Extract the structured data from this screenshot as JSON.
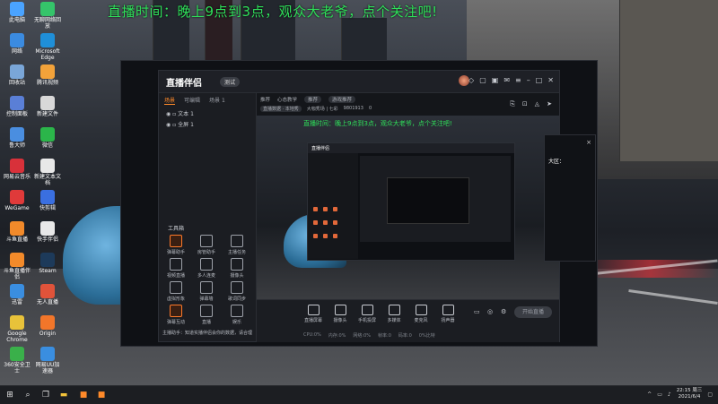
{
  "banner": "直播时间：晚上9点到3点，观众大老爷，点个关注吧!",
  "desktop_icons": [
    {
      "label": "此电脑",
      "color": "#4aa3ff"
    },
    {
      "label": "无聊网络回放",
      "color": "#35c46a"
    },
    {
      "label": "网络",
      "color": "#3b8be0"
    },
    {
      "label": "Microsoft Edge",
      "color": "#1f8fd8"
    },
    {
      "label": "回收站",
      "color": "#7aa6d8"
    },
    {
      "label": "腾讯视频",
      "color": "#f2a23a"
    },
    {
      "label": "控制面板",
      "color": "#5a7fd6"
    },
    {
      "label": "新建文件",
      "color": "#d8d8d8"
    },
    {
      "label": "鲁大师",
      "color": "#4a8ee0"
    },
    {
      "label": "微信",
      "color": "#2bb54a"
    },
    {
      "label": "网易云音乐",
      "color": "#d8313a"
    },
    {
      "label": "新建文本文档",
      "color": "#e8e8e8"
    },
    {
      "label": "WeGame",
      "color": "#e03a3a"
    },
    {
      "label": "快剪辑",
      "color": "#3a6fe0"
    },
    {
      "label": "斗鱼直播",
      "color": "#f28a2a"
    },
    {
      "label": "快手伴侣",
      "color": "#e8e8e8"
    },
    {
      "label": "斗鱼直播伴侣",
      "color": "#f28a2a"
    },
    {
      "label": "Steam",
      "color": "#1d3a5a"
    },
    {
      "label": "迅雷",
      "color": "#3a8ee0"
    },
    {
      "label": "无人直播",
      "color": "#e0533a"
    },
    {
      "label": "Google Chrome",
      "color": "#e8c23a"
    },
    {
      "label": "Origin",
      "color": "#f2762a"
    },
    {
      "label": "360安全卫士",
      "color": "#3ab04a"
    },
    {
      "label": "网易UU加速器",
      "color": "#3a8ee0"
    }
  ],
  "app": {
    "logo": "直播伴侣",
    "version": "测试",
    "title_icons": [
      "shirt-icon",
      "chat-icon",
      "gift-icon",
      "mail-icon",
      "menu-icon",
      "minimize-icon",
      "maximize-icon",
      "close-icon"
    ],
    "left_tabs": [
      "场景",
      "可编辑",
      "场景 1"
    ],
    "sources": [
      "文本 1",
      "全屏 1"
    ],
    "tools_title": "工具箱",
    "tools": [
      {
        "label": "弹幕助手",
        "hot": true
      },
      {
        "label": "房管助手",
        "hot": false
      },
      {
        "label": "主播任务",
        "hot": false
      },
      {
        "label": "视频直播",
        "hot": false
      },
      {
        "label": "多人连麦",
        "hot": false
      },
      {
        "label": "摄像头",
        "hot": false
      },
      {
        "label": "虚拟形象",
        "hot": false
      },
      {
        "label": "弹幕墙",
        "hot": false
      },
      {
        "label": "歌词同步",
        "hot": false
      },
      {
        "label": "弹幕互动",
        "hot": true
      },
      {
        "label": "直播",
        "hot": false
      },
      {
        "label": "娱乐",
        "hot": false
      }
    ],
    "notice": "主播助手：知道实播伴侣会你的数据，请合理取用管理",
    "scene_tabs": [
      "推荐",
      "心态教学",
      "推荐",
      "游戏推荐"
    ],
    "info": [
      "直播数据 · 本地秀",
      "大咖秀场 | 七彩",
      "9801913",
      "0"
    ],
    "right_icons": [
      "share-icon",
      "lock-icon",
      "bell-icon",
      "send-icon"
    ],
    "preview_banner": "直播时间：晚上9点到3点，观众大老爷，点个关注吧!",
    "bottom": [
      {
        "label": "直播屏幕",
        "icon": "screen-icon"
      },
      {
        "label": "摄像头",
        "icon": "camera-icon"
      },
      {
        "label": "手机投屏",
        "icon": "phone-icon"
      },
      {
        "label": "多媒体",
        "icon": "media-icon"
      },
      {
        "label": "麦克风",
        "icon": "mic-icon"
      },
      {
        "label": "扬声器",
        "icon": "speaker-icon"
      }
    ],
    "start_label": "开始直播",
    "stats": [
      "CPU:0%",
      "内存:0%",
      "网络:0%",
      "帧率:0",
      "码率:0",
      "0%比特"
    ]
  },
  "side_popup": {
    "title": "大区：",
    "close": "×"
  },
  "taskbar": {
    "icons": [
      "windows-icon",
      "search-icon",
      "taskview-icon",
      "file-explorer-icon",
      "live-assistant-icon",
      "live-companion-icon"
    ],
    "time": "22:15 周三",
    "date": "2021/6/4"
  }
}
